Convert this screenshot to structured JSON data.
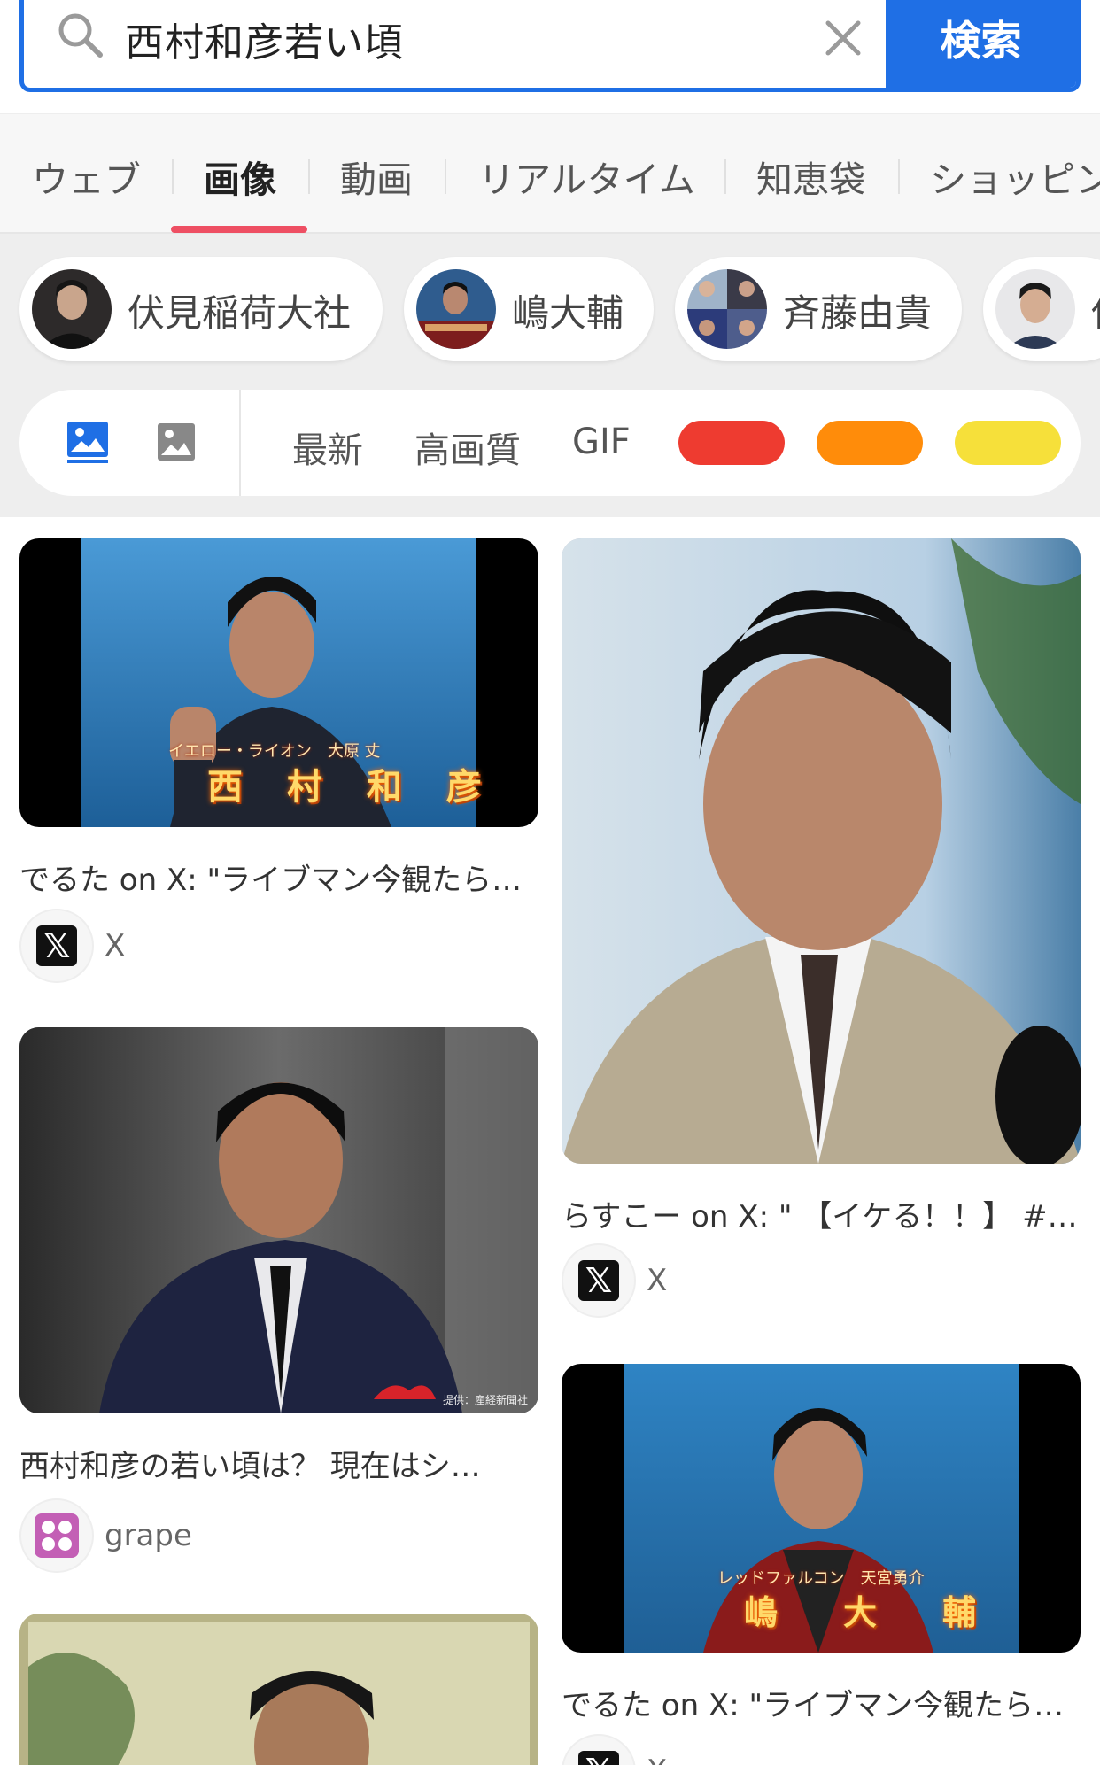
{
  "search": {
    "query": "西村和彦若い頃",
    "button_label": "検索"
  },
  "tabs": [
    {
      "label": "ウェブ",
      "active": false
    },
    {
      "label": "画像",
      "active": true
    },
    {
      "label": "動画",
      "active": false
    },
    {
      "label": "リアルタイム",
      "active": false
    },
    {
      "label": "知恵袋",
      "active": false
    },
    {
      "label": "ショッピング",
      "active": false
    }
  ],
  "related": [
    {
      "label": "伏見稲荷大社"
    },
    {
      "label": "嶋大輔"
    },
    {
      "label": "斉藤由貴"
    },
    {
      "label": "伊"
    }
  ],
  "filters": {
    "latest": "最新",
    "hq": "高画質",
    "gif": "GIF",
    "colors": [
      "#ee3b30",
      "#ff8c0a",
      "#f6e03a"
    ]
  },
  "results": [
    {
      "title": "でるた on X: \"ライブマン今観たら…",
      "source": "X",
      "caption_main": "西 村 和 彦",
      "caption_sub": "イエロー・ライオン　大原 丈"
    },
    {
      "title": "西村和彦の若い頃は？ 現在はシ…",
      "source": "grape",
      "watermark": "提供：産経新聞社"
    },
    {
      "title": "らすこー on X: \" 【イケる！！】 #…",
      "source": "X"
    },
    {
      "title": "でるた on X: \"ライブマン今観たら…",
      "source": "X",
      "caption_main": "嶋　大　輔",
      "caption_sub": "レッドファルコン　天宮勇介"
    }
  ]
}
